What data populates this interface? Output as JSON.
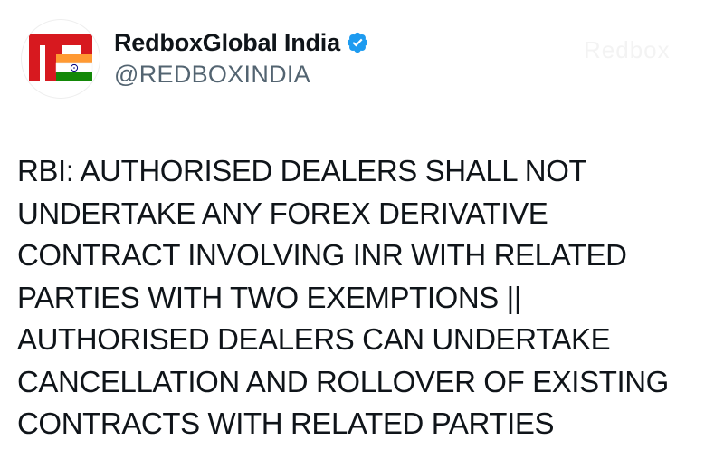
{
  "account": {
    "display_name": "RedboxGlobal India",
    "handle": "@REDBOXINDIA",
    "verified_icon": "verified-badge-icon",
    "avatar_icon": "redbox-india-flag-logo"
  },
  "watermark": {
    "text": "Redbox"
  },
  "tweet": {
    "text": "RBI: AUTHORISED DEALERS SHALL NOT\nUNDERTAKE ANY FOREX DERIVATIVE\nCONTRACT INVOLVING INR WITH RELATED\nPARTIES WITH TWO EXEMPTIONS ||\nAUTHORISED DEALERS CAN UNDERTAKE\nCANCELLATION AND ROLLOVER OF EXISTING\nCONTRACTS WITH RELATED PARTIES"
  },
  "colors": {
    "brand_red": "#d7191f",
    "flag_saffron": "#ff9933",
    "flag_green": "#138808",
    "chakra_blue": "#000080",
    "verified_blue": "#1d9bf0",
    "handle_gray": "#536471"
  }
}
